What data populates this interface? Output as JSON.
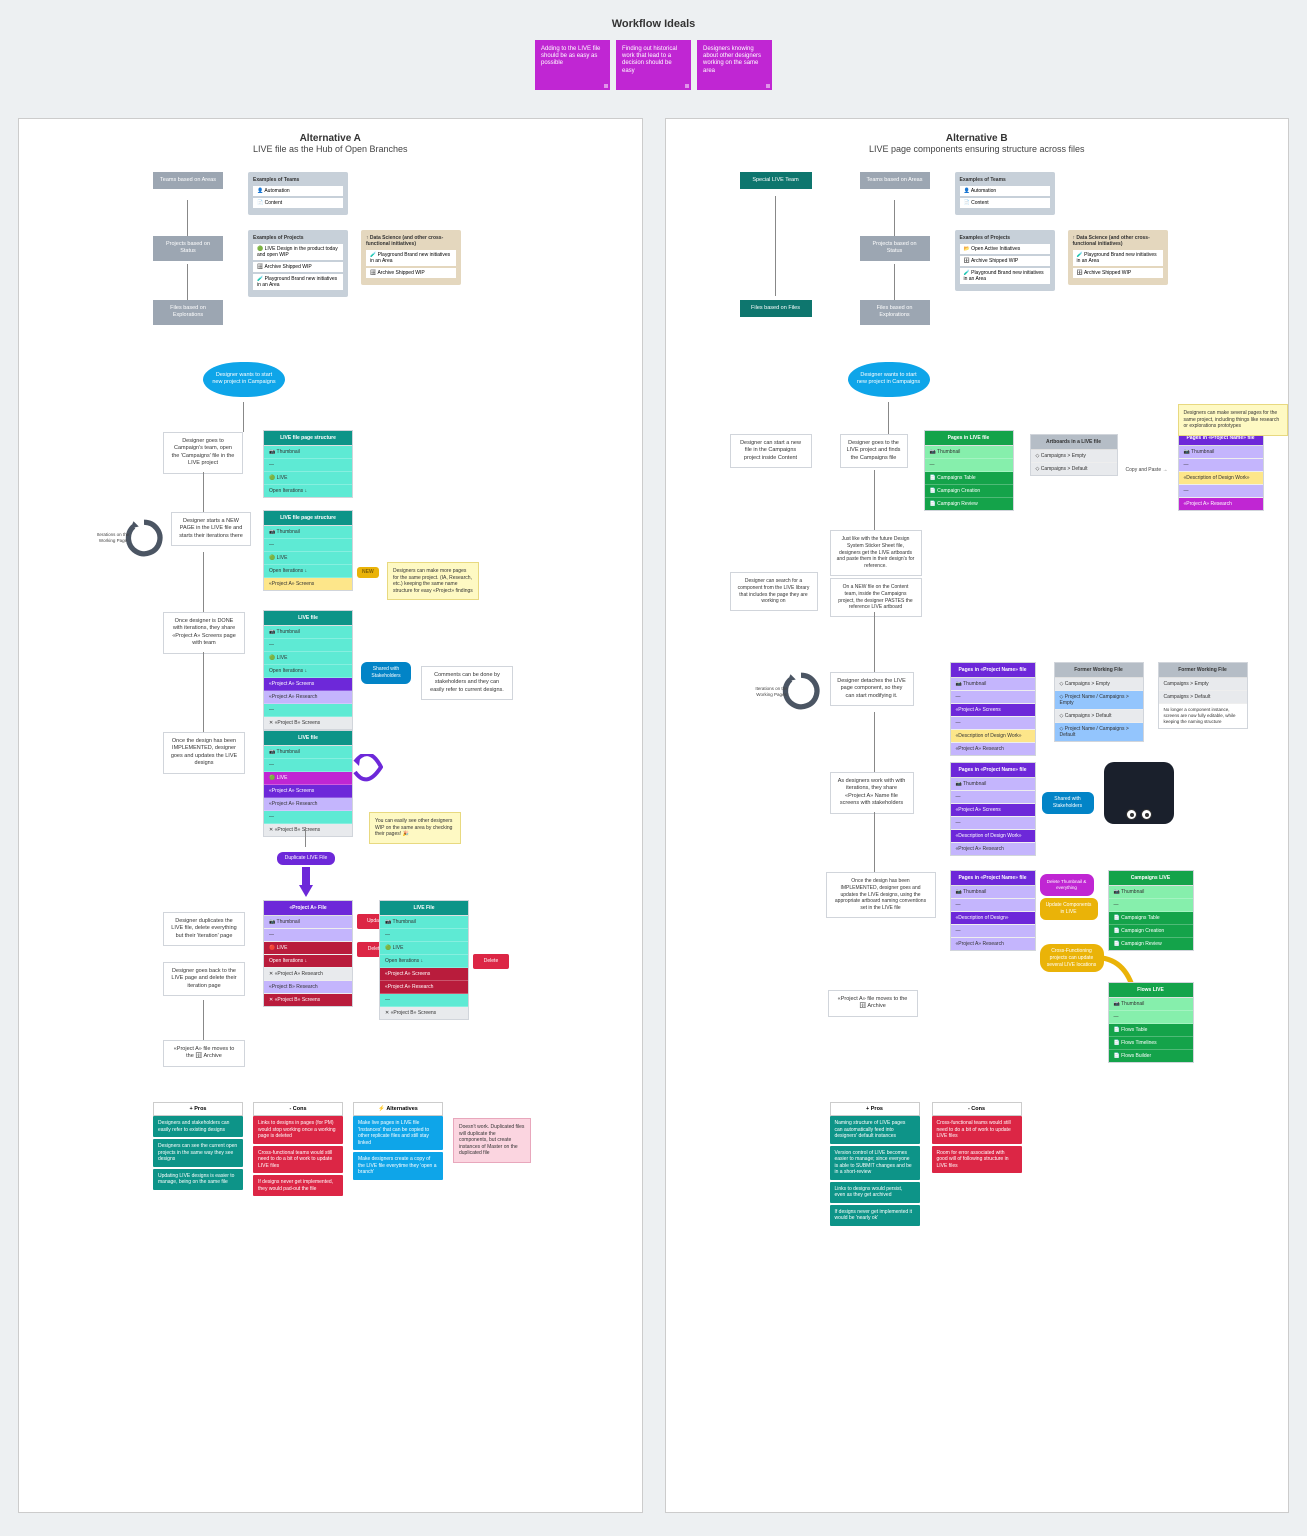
{
  "title": "Workflow Ideals",
  "ideals": [
    "Adding to the LIVE file should be as easy as possible",
    "Finding out historical work that lead to a decision should be easy",
    "Designers knowing about other designers working on the same area"
  ],
  "altA": {
    "title": "Alternative A",
    "subtitle": "LIVE file as the Hub of Open Branches",
    "teams": "Teams\nbased on Areas",
    "projects": "Projects\nbased on Status",
    "files": "Files\nbased on Explorations",
    "exTeams": {
      "h": "Examples of Teams",
      "r": [
        "👤 Automation",
        "📄 Content"
      ]
    },
    "exProjects": {
      "h": "Examples of Projects",
      "r": [
        "🟢 LIVE\nDesign in the product today and open WIP",
        "🗄 Archive\nShipped WIP",
        "🧪 Playground\nBrand new initiatives in an Area"
      ]
    },
    "dataSci": {
      "h": "↑ Data Science\n(and other cross-functional initiatives)",
      "r": [
        "🧪 Playground\nBrand new initiatives in an Area",
        "🗄 Archive\nShipped WIP"
      ]
    },
    "cloud": "Designer wants to start new project in Campaigns",
    "s1": "Designer goes to Campaign's team, open the 'Campaigns' file in the LIVE project",
    "s2": "Designer starts a NEW PAGE in the LIVE file and starts their iterations there",
    "s3": "Once designer is DONE with iterations, they share «Project A» Screens page with team",
    "s4": "Once the design has been IMPLEMENTED, designer goes and updates the LIVE designs",
    "s5": "Designer duplicates the LIVE file, delete everything but their 'iteration' page",
    "s6": "Designer goes back to the LIVE page and delete their iteration page",
    "s7": "«Project A» file moves to the 🗄 Archive",
    "loopLbl": "Iterations on the Working Page",
    "newTag": "NEW",
    "stk1": "Designers can make more pages for the same project. (IA, Research, etc.) keeping the same name structure for easy «Project» findings",
    "stk2": "Comments can be done by stakeholders and they can easily refer to current designs.",
    "stk3": "You can easily see other designers WIP on the same area by checking their pages! 🎉",
    "blueTag": "Shared with Stakeholders",
    "dupArrow": "Duplicate LIVE File",
    "redUpdate": "Update",
    "redDelete": "Delete",
    "redDel2": "Delete",
    "file1": {
      "h": "LIVE file page structure",
      "rows": [
        "📷 Thumbnail",
        "—",
        "🟢 LIVE",
        "Open Iterations ↓"
      ]
    },
    "file2": {
      "h": "LIVE file page structure",
      "rows": [
        "📷 Thumbnail",
        "—",
        "🟢 LIVE",
        "Open Iterations ↓",
        "«Project A» Screens"
      ]
    },
    "file3": {
      "h": "LIVE file",
      "rows": [
        "📷 Thumbnail",
        "—",
        "🟢 LIVE",
        "Open Iterations ↓",
        "«Project A» Screens",
        "«Project A» Research",
        "—",
        "✕ «Project B» Screens"
      ]
    },
    "file4": {
      "h": "LIVE file",
      "rows": [
        "📷 Thumbnail",
        "—",
        "🟢 LIVE",
        "«Project A» Screens",
        "«Project A» Research",
        "—",
        "✕ «Project B» Screens"
      ]
    },
    "file5": {
      "h": "«Project A» File",
      "rows": [
        "📷 Thumbnail",
        "—",
        "🔴 LIVE",
        "Open Iterations ↓",
        "✕ «Project A» Research",
        "«Project B» Research",
        "✕ «Project B» Screens"
      ]
    },
    "file6": {
      "h": "LIVE File",
      "rows": [
        "📷 Thumbnail",
        "—",
        "🟢 LIVE",
        "Open Iterations ↓",
        "«Project A» Screens",
        "«Project A» Research",
        "—",
        "✕ «Project B» Screens"
      ]
    },
    "prosH": "+    Pros",
    "consH": "-    Cons",
    "altH": "⚡    Alternatives",
    "pros": [
      "Designers and stakeholders can easily refer to existing designs",
      "Designers can see the current open projects in the same way they see designs",
      "Updating LIVE designs is easier to manage, being on the same file"
    ],
    "cons": [
      "Links to designs in pages (for PM) would stop working once a working page is deleted",
      "Cross-functional teams would still need to do a bit of work to update LIVE files",
      "If designs never get implemented, they would pad-out the file"
    ],
    "alt": [
      "Make live pages in LIVE file 'Instances' that can be copied to other replicate files and still stay linked",
      "Make designers create a copy of the LIVE file everytime they 'open a branch'"
    ],
    "altNote": "Doesn't work. Duplicated files will duplicate the components, but create instances of Master on the duplicated file"
  },
  "altB": {
    "title": "Alternative B",
    "subtitle": "LIVE page components ensuring structure across files",
    "special": "Special LIVE Team",
    "teams": "Teams\nbased on Areas",
    "projects": "Projects\nbased on Status",
    "files1": "Files\nbased on Files",
    "files2": "Files\nbased on Explorations",
    "exTeams": {
      "h": "Examples of Teams",
      "r": [
        "👤 Automation",
        "📄 Content"
      ]
    },
    "exProjects": {
      "h": "Examples of Projects",
      "r": [
        "📂 Open\nActive Initiatives",
        "🗄 Archive\nShipped WIP",
        "🧪 Playground\nBrand new initiatives in an Area"
      ]
    },
    "dataSci": {
      "h": "↑ Data Science\n(and other cross-functional initiatives)",
      "r": [
        "🧪 Playground\nBrand new initiatives in an Area",
        "🗄 Archive\nShipped WIP"
      ]
    },
    "cloud": "Designer wants to start new project in Campaigns",
    "s1": "Designer can start a new file in the Campaigns project inside Content",
    "s2": "Designer goes to the LIVE project and finds the Campaigns file",
    "s3": "Just like with the future Design System Sticker Sheet file, designers get the LIVE artboards and paste them in their design's for reference.",
    "s4": "Designer can search for a component from the LIVE library that includes the page they are working on",
    "s5": "On a NEW file on the Content team, inside the Campaigns project, the designer PASTES the reference LIVE artboard",
    "stkTop": "Designers can make several pages for the same project, including things like research or explorations prototypes",
    "loopLbl": "Iterations on the Working Pages",
    "s6": "Designer detaches the LIVE page component, so they can start modifying it.",
    "s7": "As designers work with with iterations, they share «Project A» Name file screens with stakeholders",
    "s8": "Once the design has been IMPLEMENTED, designer goes and updates the LIVE designs, using the appropriate artboard naming conventions set in the LIVE file",
    "s9": "«Project A» file moves to the 🗄 Archive",
    "greenFile": {
      "h": "Pages in LIVE file",
      "rows": [
        "📷 Thumbnail",
        "—",
        "📄 Campaigns Table",
        "📄 Campaign Creation",
        "📄 Campaign Review"
      ]
    },
    "abFile": {
      "h": "Artboards in a LIVE file",
      "rows": [
        "◇ Campaigns > Empty",
        "◇ Campaigns > Default"
      ]
    },
    "copyPaste": "Copy and Paste →",
    "purFile1": {
      "h": "Pages in «Project Name» file",
      "r": [
        "📷 Thumbnail",
        "—",
        "«Description of Design Work»",
        "—",
        "«Project A» Research"
      ]
    },
    "purFile2": {
      "h": "Pages in «Project Name» file",
      "r": [
        "📷 Thumbnail",
        "—",
        "«Project A» Screens",
        "—",
        "«Description of Design Work»",
        "«Project A» Research"
      ]
    },
    "fwork": {
      "h": "Former Working File",
      "r": [
        "◇ Campaigns > Empty",
        "◇ Project Name / Campaigns > Empty",
        "◇ Campaigns > Default",
        "◇ Project Name / Campaigns > Default"
      ]
    },
    "fwork2": {
      "h": "Former Working File",
      "r": [
        "Campaigns > Empty",
        "Campaigns > Default"
      ],
      "note": "No longer a component instance, screens are now fully editable, while keeping the naming structure"
    },
    "purFile3": {
      "h": "Pages in «Project Name» file",
      "r": [
        "📷 Thumbnail",
        "—",
        "«Project A» Screens",
        "—",
        "«Description of Design Work»",
        "«Project A» Research"
      ]
    },
    "shareTag": "Shared with Stakeholders",
    "purFile4": {
      "h": "Pages in «Project Name» file",
      "r": [
        "📷 Thumbnail",
        "—",
        "«Description of Design»",
        "—",
        "«Project A» Research"
      ]
    },
    "delRef": "Delete Thumbnail & everything",
    "updComp": "Update Components in LIVE",
    "yBubble": "Cross-Functioning projects can update several LIVE locations",
    "campLive": {
      "h": "Campaigns LIVE",
      "r": [
        "📷 Thumbnail",
        "—",
        "📄 Campaigns Table",
        "📄 Campaign Creation",
        "📄 Campaign Review"
      ]
    },
    "flowLive": {
      "h": "Flows LIVE",
      "r": [
        "📷 Thumbnail",
        "—",
        "📄 Flows Table",
        "📄 Flows Timelines",
        "📄 Flows Builder"
      ]
    },
    "prosH": "+    Pros",
    "consH": "-    Cons",
    "pros": [
      "Naming structure of LIVE pages can automatically feed into designers' default instances",
      "Version control of LIVE becomes easier to manage; since everyone is able to SUBMIT changes and be in a short-review",
      "Links to designs would persist, even as they get archived",
      "If designs never get implemented it would be 'nearly ok'"
    ],
    "cons": [
      "Cross-functional teams would still need to do a bit of work to update LIVE files",
      "Room for error associated with good will of following structure in LIVE files"
    ]
  }
}
